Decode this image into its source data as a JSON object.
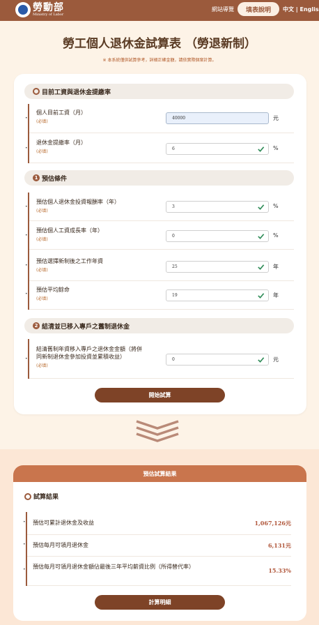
{
  "header": {
    "logo_cn": "勞動部",
    "logo_en": "Ministry of Labor",
    "sitemap": "網站導覽",
    "guide": "填表說明",
    "lang": "中文 | English"
  },
  "title": "勞工個人退休金試算表 （勞退新制）",
  "notice": "※ 本系統僅供試算參考，詳細正確金額，請依實際個案計算。",
  "required": "(必填)",
  "sections": {
    "current": "目前工資與退休金提繳率",
    "estimate": "預估條件",
    "estimate_num": "1",
    "settle": "結清並已移入專戶之舊制退休金",
    "settle_num": "2"
  },
  "fields": {
    "salary": {
      "label": "個人目前工資（月）",
      "value": "40000",
      "unit": "元"
    },
    "contribution": {
      "label": "退休金提繳率（月）",
      "value": "6",
      "unit": "%"
    },
    "return_rate": {
      "label": "預估個人退休金投資報酬率（年）",
      "value": "3",
      "unit": "%"
    },
    "growth": {
      "label": "預估個人工資成長率（年）",
      "value": "0",
      "unit": "%"
    },
    "years": {
      "label": "預估選擇新制後之工作年資",
      "value": "25",
      "unit": "年"
    },
    "life": {
      "label": "預估平均餘命",
      "value": "19",
      "unit": "年"
    },
    "old_pension": {
      "label_1": "結清舊制年資移入專戶之退休金金額（將併",
      "label_2": "同新制退休金參加投資並累積收益）",
      "value": "0",
      "unit": "元"
    }
  },
  "buttons": {
    "calculate": "開始試算",
    "detail": "計算明細"
  },
  "results": {
    "header": "預估試算結果",
    "subheader": "試算結果",
    "items": [
      {
        "label": "預估可累計退休金及收益",
        "value": "1,067,126元"
      },
      {
        "label": "預估每月可領月退休金",
        "value": "6,131元"
      },
      {
        "label": "預估每月可領月退休金額佔最後三年平均薪資比例（所得替代率）",
        "value": "15.33%"
      }
    ]
  },
  "colors": {
    "brand": "#9b5a3c",
    "button": "#7e4327",
    "result_header": "#c9754d",
    "value": "#b0563a",
    "check": "#2e8b57"
  }
}
